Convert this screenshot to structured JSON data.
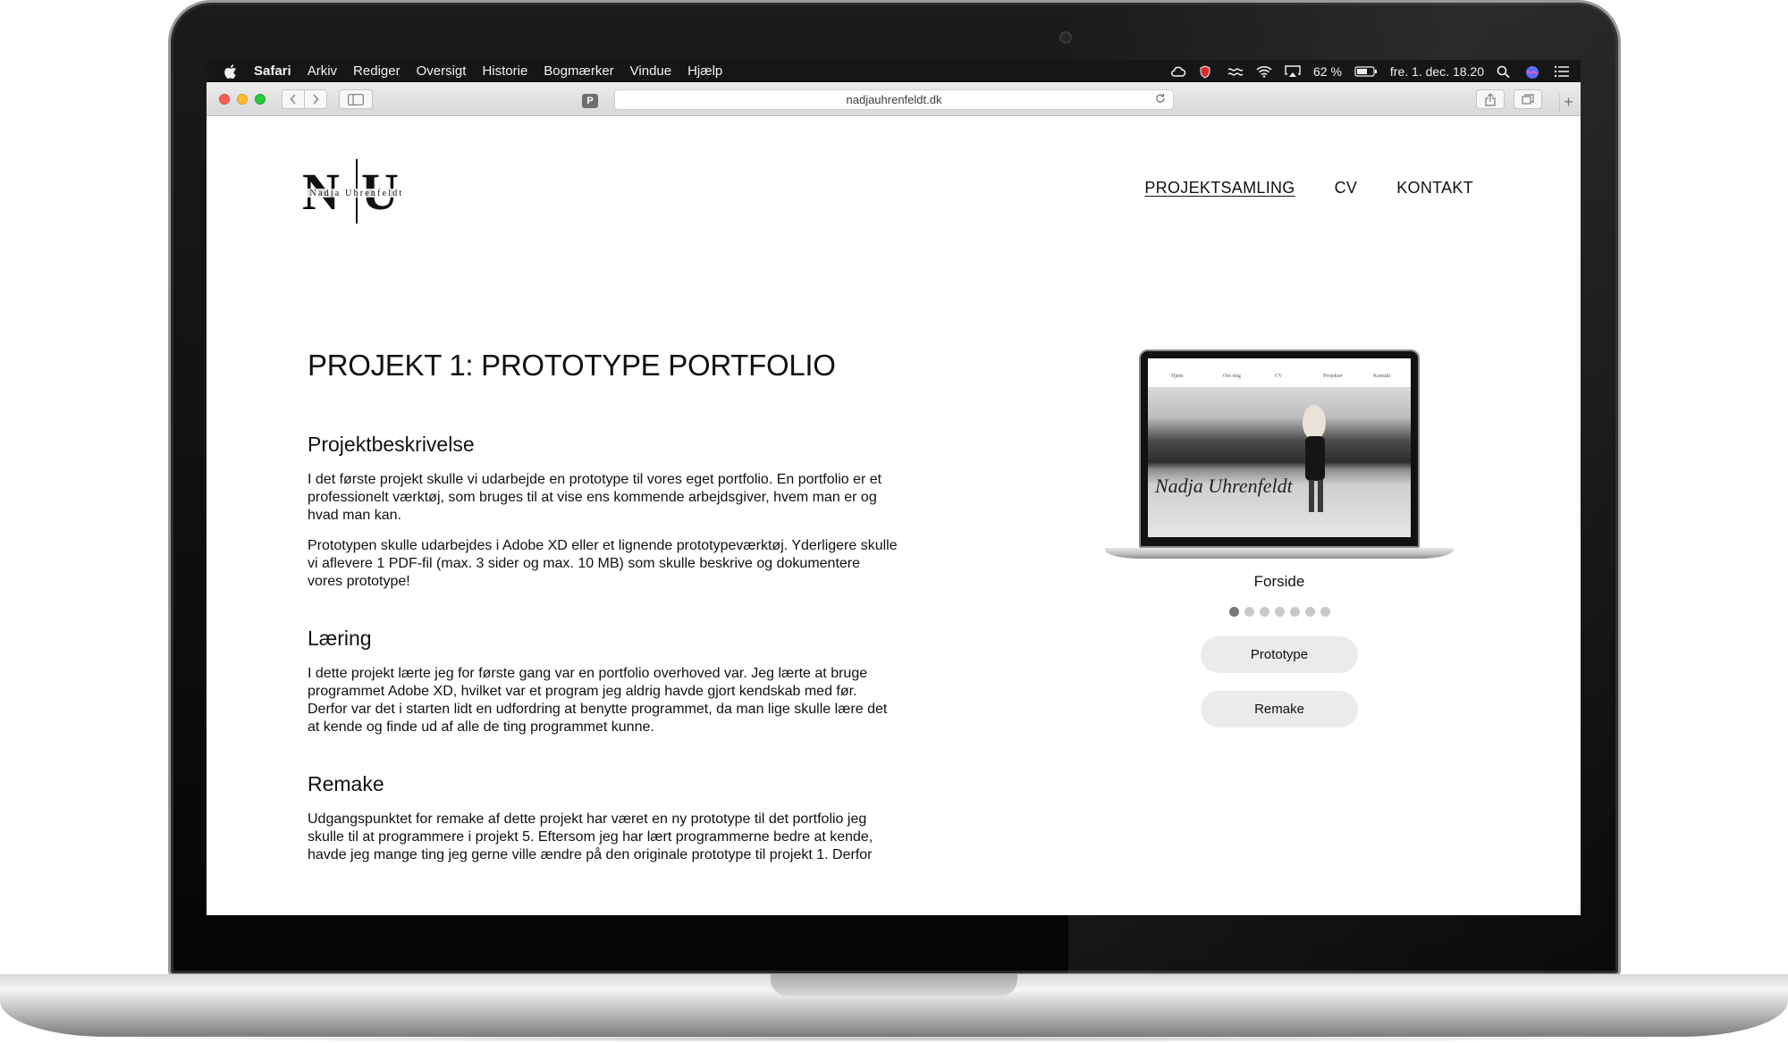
{
  "menubar": {
    "app": "Safari",
    "items": [
      "Arkiv",
      "Rediger",
      "Oversigt",
      "Historie",
      "Bogmærker",
      "Vindue",
      "Hjælp"
    ],
    "battery": "62 %",
    "clock": "fre. 1. dec.  18.20"
  },
  "browser": {
    "pin_label": "P",
    "url": "nadjauhrenfeldt.dk"
  },
  "site": {
    "logo_mark": "N|U",
    "logo_name": "Nadja Uhrenfeldt",
    "nav": [
      "PROJEKTSAMLING",
      "CV",
      "KONTAKT"
    ]
  },
  "project": {
    "title": "PROJEKT 1: PROTOTYPE PORTFOLIO",
    "sections": [
      {
        "heading": "Projektbeskrivelse",
        "paragraphs": [
          "I det første projekt skulle vi udarbejde en prototype til vores eget portfolio. En portfolio er et professionelt værktøj, som bruges til at vise ens kommende arbejdsgiver, hvem man er og hvad man kan.",
          "Prototypen skulle udarbejdes i Adobe XD eller et lignende prototypeværktøj. Yderligere skulle vi aflevere 1 PDF-fil (max. 3 sider og max. 10 MB) som skulle beskrive og dokumentere vores prototype!"
        ]
      },
      {
        "heading": "Læring",
        "paragraphs": [
          "I dette projekt lærte jeg for første gang var en portfolio overhoved var. Jeg lærte at bruge programmet Adobe XD, hvilket var et program jeg aldrig havde gjort kendskab med før. Derfor var det i starten lidt en udfordring at benytte programmet, da man lige skulle lære det at kende og finde ud af alle de ting programmet kunne."
        ]
      },
      {
        "heading": "Remake",
        "paragraphs": [
          "Udgangspunktet for remake af dette projekt har været en ny prototype til det portfolio jeg skulle til at programmere i projekt 5. Eftersom jeg har lært programmerne bedre at kende, havde jeg mange ting jeg gerne ville ændre på den originale prototype til projekt 1. Derfor"
        ]
      }
    ]
  },
  "gallery": {
    "caption": "Forside",
    "dot_count": 7,
    "active_dot": 0,
    "mini_nav": [
      "Hjem",
      "Om mig",
      "CV",
      "Projekter",
      "Kontakt"
    ],
    "mini_signature": "Nadja Uhrenfeldt",
    "buttons": [
      "Prototype",
      "Remake"
    ]
  }
}
